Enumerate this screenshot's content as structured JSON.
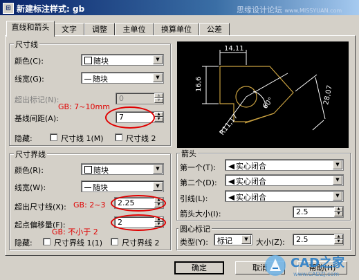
{
  "window": {
    "title": "新建标注样式: gb",
    "watermark_top": "思缘设计论坛",
    "watermark_top_url": "www.MISSYUAN.com",
    "icon_glyph": "⊞"
  },
  "tabs": [
    "直线和箭头",
    "文字",
    "调整",
    "主单位",
    "换算单位",
    "公差"
  ],
  "dim_lines": {
    "title": "尺寸线",
    "color_label": "颜色(C):",
    "color_value": "随块",
    "lineweight_label": "线宽(G):",
    "lineweight_value": "随块",
    "extend_label": "超出标记(N):",
    "extend_value": "0",
    "spacing_label": "基线间距(A):",
    "spacing_value": "7",
    "suppress_label": "隐藏:",
    "suppress_1": "尺寸线 1(M)",
    "suppress_2": "尺寸线 2"
  },
  "ext_lines": {
    "title": "尺寸界线",
    "color_label": "颜色(R):",
    "color_value": "随块",
    "lineweight_label": "线宽(W):",
    "lineweight_value": "随块",
    "extend_label": "超出尺寸线(X):",
    "extend_value": "2.25",
    "offset_label": "起点偏移量(F):",
    "offset_value": "2",
    "suppress_label": "隐藏:",
    "suppress_1": "尺寸界线 1(1)",
    "suppress_2": "尺寸界线 2"
  },
  "arrowheads": {
    "title": "箭头",
    "first_label": "第一个(T):",
    "first_value": "实心闭合",
    "second_label": "第二个(D):",
    "second_value": "实心闭合",
    "leader_label": "引线(L):",
    "leader_value": "实心闭合",
    "size_label": "箭头大小(I):",
    "size_value": "2.5"
  },
  "center_marks": {
    "title": "圆心标记",
    "type_label": "类型(Y):",
    "type_value": "标记",
    "size_label": "大小(Z):",
    "size_value": "2.5"
  },
  "annotations": {
    "spacing_note": "GB: 7~10mm",
    "extend_note": "GB: 2~3",
    "offset_note": "GB: 不小于 2"
  },
  "preview": {
    "dim_top": "14,11",
    "dim_left": "16,6",
    "dim_right": "28,07",
    "angle": "60°",
    "radius": "R11,17"
  },
  "buttons": {
    "ok": "确定",
    "cancel": "取消",
    "help": "帮助(H)"
  },
  "watermark_bottom": {
    "brand": "CAD之家",
    "url": "www.CADZJ.com"
  },
  "colors": {
    "preview_bg": "#000000",
    "preview_lines": "#ffffff",
    "preview_shape": "#c8a040",
    "annotation": "#e00000"
  }
}
